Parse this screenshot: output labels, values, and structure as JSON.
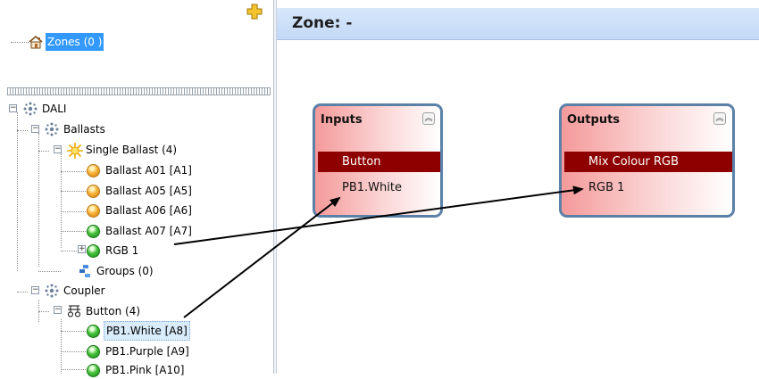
{
  "zones_panel": {
    "root_label": "Zones (0 )",
    "root_icon": "house-icon"
  },
  "tree": {
    "dali": "DALI",
    "ballasts": "Ballasts",
    "single_ballast": "Single Ballast (4)",
    "ballast_items": [
      "Ballast A01 [A1]",
      "Ballast A05 [A5]",
      "Ballast A06 [A6]",
      "Ballast A07 [A7]"
    ],
    "rgb": "RGB 1",
    "groups": "Groups (0)",
    "coupler": "Coupler",
    "button": "Button (4)",
    "pb_items": [
      "PB1.White [A8]",
      "PB1.Purple [A9]",
      "PB1.Pink [A10]"
    ]
  },
  "header": {
    "title": "Zone: -",
    "background_color": "#cfe1f8"
  },
  "inputs_node": {
    "title": "Inputs",
    "bar_label": "Button",
    "item": "PB1.White"
  },
  "outputs_node": {
    "title": "Outputs",
    "bar_label": "Mix Colour RGB",
    "item": "RGB 1"
  },
  "colors": {
    "node_border": "#5b81a8",
    "node_bar": "#8e0000",
    "selection": "#3399ff"
  }
}
